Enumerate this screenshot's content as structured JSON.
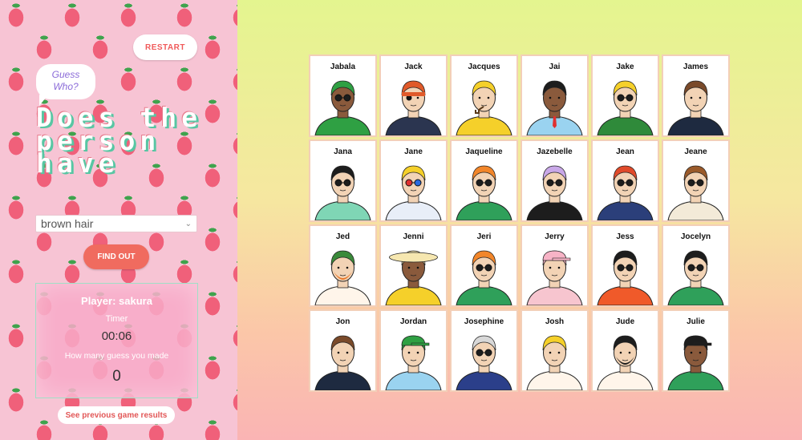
{
  "sidebar": {
    "restart_label": "RESTART",
    "bubble_line1": "Guess",
    "bubble_line2": "Who?",
    "question": "Does the person have",
    "select_value": "brown hair",
    "find_out_label": "FIND OUT",
    "player_label": "Player: sakura",
    "timer_label": "Timer",
    "timer_value": "00:06",
    "guesses_label": "How many guess you made",
    "guesses_value": "0",
    "previous_results_label": "See previous game results"
  },
  "colors": {
    "accent": "#f06b5f",
    "sidebar_bg": "#f7c4d4",
    "strawberry": "#f0607a",
    "board_bg_top": "#e4f58f",
    "board_bg_bottom": "#fab4b4"
  },
  "characters": [
    {
      "name": "Jabala",
      "skin": "#8a5a3c",
      "hair": "#2fa043",
      "shirt": "#2fa043",
      "acc": "glasses"
    },
    {
      "name": "Jack",
      "skin": "#f2d3b5",
      "hair": "#e05a2a",
      "shirt": "#2b3550",
      "acc": "eyepatch"
    },
    {
      "name": "Jacques",
      "skin": "#f2d3b5",
      "hair": "#f5d02a",
      "shirt": "#f5d02a",
      "acc": "pipe"
    },
    {
      "name": "Jai",
      "skin": "#8a5a3c",
      "hair": "#1d1d1d",
      "shirt": "#9ad3f0",
      "acc": "tie"
    },
    {
      "name": "Jake",
      "skin": "#f2d3b5",
      "hair": "#f5d02a",
      "shirt": "#2f8a3a",
      "acc": "glasses"
    },
    {
      "name": "James",
      "skin": "#f2d3b5",
      "hair": "#7a4a2a",
      "shirt": "#1e2a40",
      "acc": "none"
    },
    {
      "name": "Jana",
      "skin": "#f2d3b5",
      "hair": "#1d1d1d",
      "shirt": "#7fd6b5",
      "acc": "glasses"
    },
    {
      "name": "Jane",
      "skin": "#f2d3b5",
      "hair": "#f5d02a",
      "shirt": "#e8eef8",
      "acc": "glasses3d"
    },
    {
      "name": "Jaqueline",
      "skin": "#f2d3b5",
      "hair": "#f2862a",
      "shirt": "#2fa05a",
      "acc": "glasses"
    },
    {
      "name": "Jazebelle",
      "skin": "#f2d3b5",
      "hair": "#c9a8e8",
      "shirt": "#1d1d1d",
      "acc": "glasses"
    },
    {
      "name": "Jean",
      "skin": "#f2d3b5",
      "hair": "#e04a2a",
      "shirt": "#2b3f7a",
      "acc": "glasses"
    },
    {
      "name": "Jeane",
      "skin": "#f2d3b5",
      "hair": "#9a5a2a",
      "shirt": "#f3ead8",
      "acc": "glasses"
    },
    {
      "name": "Jed",
      "skin": "#f2d3b5",
      "hair": "#3a8a3a",
      "shirt": "#fff5ea",
      "acc": "beard"
    },
    {
      "name": "Jenni",
      "skin": "#8a5a3c",
      "hair": "#f6e7b0",
      "shirt": "#f5d02a",
      "acc": "hat"
    },
    {
      "name": "Jeri",
      "skin": "#f2d3b5",
      "hair": "#f2862a",
      "shirt": "#2fa05a",
      "acc": "glasses"
    },
    {
      "name": "Jerry",
      "skin": "#f2d3b5",
      "hair": "#f7b3c6",
      "shirt": "#f7c5cf",
      "acc": "cap"
    },
    {
      "name": "Jess",
      "skin": "#f2d3b5",
      "hair": "#1d1d1d",
      "shirt": "#f05a2a",
      "acc": "glasses"
    },
    {
      "name": "Jocelyn",
      "skin": "#f2d3b5",
      "hair": "#1d1d1d",
      "shirt": "#2fa05a",
      "acc": "glasses"
    },
    {
      "name": "Jon",
      "skin": "#f2d3b5",
      "hair": "#7a4a2a",
      "shirt": "#1e2a40",
      "acc": "none"
    },
    {
      "name": "Jordan",
      "skin": "#f2d3b5",
      "hair": "#2fa043",
      "shirt": "#9ad3f0",
      "acc": "cap"
    },
    {
      "name": "Josephine",
      "skin": "#f2d3b5",
      "hair": "#d8d8d8",
      "shirt": "#2b3f8a",
      "acc": "glasses"
    },
    {
      "name": "Josh",
      "skin": "#f2d3b5",
      "hair": "#f5d02a",
      "shirt": "#fff5ea",
      "acc": "none"
    },
    {
      "name": "Jude",
      "skin": "#f2d3b5",
      "hair": "#1d1d1d",
      "shirt": "#fff5ea",
      "acc": "beard"
    },
    {
      "name": "Julie",
      "skin": "#8a5a3c",
      "hair": "#1d1d1d",
      "shirt": "#2fa05a",
      "acc": "cap"
    }
  ]
}
